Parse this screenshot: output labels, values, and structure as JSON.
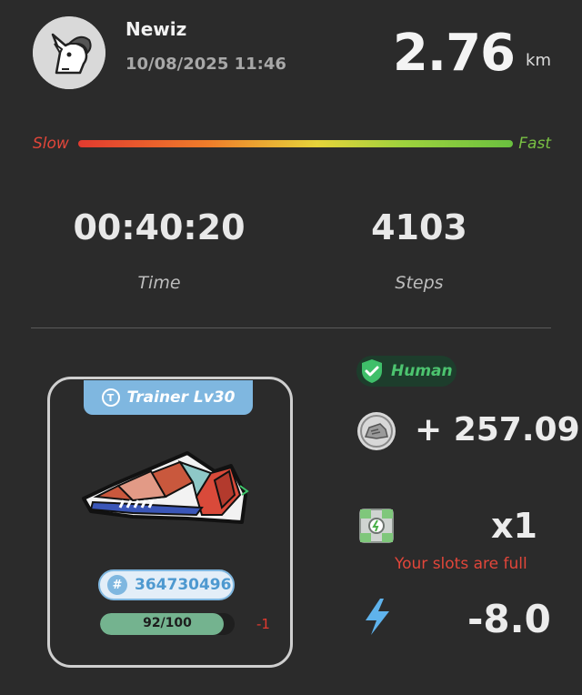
{
  "header": {
    "username": "Newiz",
    "datetime": "10/08/2025 11:46",
    "distance": "2.76",
    "distance_unit": "km"
  },
  "speed": {
    "slow_label": "Slow",
    "fast_label": "Fast"
  },
  "stats": {
    "time_value": "00:40:20",
    "time_label": "Time",
    "steps_value": "4103",
    "steps_label": "Steps"
  },
  "sneaker": {
    "tag_icon_letter": "T",
    "tag_label": "Trainer Lv30",
    "id_prefix": "#",
    "id": "364730496",
    "durability_text": "92/100",
    "durability_fraction": 0.92,
    "durability_delta": "-1"
  },
  "rewards": {
    "badge_label": "Human",
    "earned": "+ 257.09",
    "mystery_box_count": "x1",
    "slots_message": "Your slots are full",
    "energy": "-8.0"
  },
  "colors": {
    "background": "#2b2b2b",
    "accent_blue": "#7fb7e0",
    "accent_green": "#4cc46f",
    "warning_red": "#e2463a"
  },
  "icons": [
    "unicorn-avatar-icon",
    "trainer-icon",
    "sneaker-image",
    "hash-icon",
    "shield-check-icon",
    "sneaker-coin-icon",
    "mystery-box-icon",
    "lightning-bolt-icon"
  ]
}
